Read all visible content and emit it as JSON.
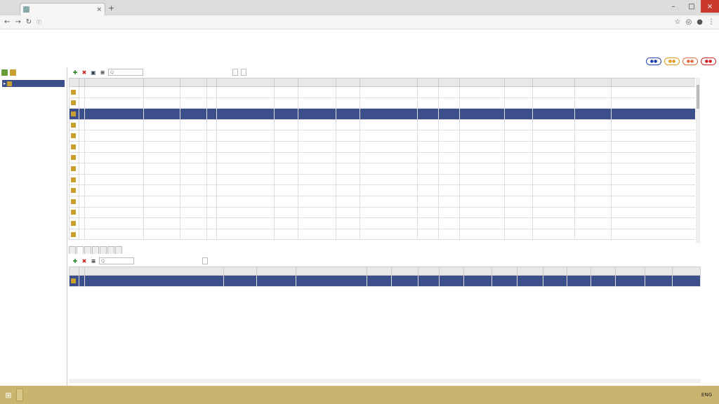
{
  "browser": {
    "tab_title": "",
    "url": "",
    "secure_label": ""
  },
  "menu": {
    "items": [],
    "user": ""
  },
  "breadcrumb": "",
  "tree": {
    "root_label": "",
    "node_label": ""
  },
  "toolbar": {
    "search_placeholder": "Q",
    "go_label": "",
    "page_info": "",
    "actions_label": ""
  },
  "columns": [
    "",
    "",
    "",
    "",
    "",
    "",
    "",
    "",
    "",
    "",
    "",
    "",
    "",
    "",
    "",
    "",
    "",
    ""
  ],
  "rows": [
    [
      "",
      "",
      "",
      "",
      "",
      "",
      "",
      "",
      "",
      "",
      "",
      "",
      "",
      "",
      "",
      "",
      ""
    ],
    [
      "",
      "",
      "",
      "",
      "",
      "",
      "",
      "",
      "",
      "",
      "",
      "",
      "",
      "",
      "",
      "",
      ""
    ],
    [
      "",
      "",
      "",
      "",
      "",
      "",
      "",
      "",
      "",
      "",
      "",
      "",
      "",
      "",
      "",
      "",
      ""
    ],
    [
      "",
      "",
      "",
      "",
      "",
      "",
      "",
      "",
      "",
      "",
      "",
      "",
      "",
      "",
      "",
      "",
      ""
    ],
    [
      "",
      "",
      "",
      "",
      "",
      "",
      "",
      "",
      "",
      "",
      "",
      "",
      "",
      "",
      "",
      "",
      ""
    ],
    [
      "",
      "",
      "",
      "",
      "",
      "",
      "",
      "",
      "",
      "",
      "",
      "",
      "",
      "",
      "",
      "",
      ""
    ],
    [
      "",
      "",
      "",
      "",
      "",
      "",
      "",
      "",
      "",
      "",
      "",
      "",
      "",
      "",
      "",
      "",
      ""
    ],
    [
      "",
      "",
      "",
      "",
      "",
      "",
      "",
      "",
      "",
      "",
      "",
      "",
      "",
      "",
      "",
      "",
      ""
    ],
    [
      "",
      "",
      "",
      "",
      "",
      "",
      "",
      "",
      "",
      "",
      "",
      "",
      "",
      "",
      "",
      "",
      ""
    ],
    [
      "",
      "",
      "",
      "",
      "",
      "",
      "",
      "",
      "",
      "",
      "",
      "",
      "",
      "",
      "",
      "",
      ""
    ],
    [
      "",
      "",
      "",
      "",
      "",
      "",
      "",
      "",
      "",
      "",
      "",
      "",
      "",
      "",
      "",
      "",
      ""
    ],
    [
      "",
      "",
      "",
      "",
      "",
      "",
      "",
      "",
      "",
      "",
      "",
      "",
      "",
      "",
      "",
      "",
      ""
    ],
    [
      "",
      "",
      "",
      "",
      "",
      "",
      "",
      "",
      "",
      "",
      "",
      "",
      "",
      "",
      "",
      "",
      ""
    ],
    [
      "",
      "",
      "",
      "",
      "",
      "",
      "",
      "",
      "",
      "",
      "",
      "",
      "",
      "",
      "",
      "",
      ""
    ]
  ],
  "selected_row": 2,
  "lower_tabs": [],
  "lower_toolbar": {
    "go_label": "",
    "actions_label": "",
    "page_info": ""
  },
  "lower_columns": [
    "",
    "",
    "",
    "",
    "",
    "",
    "",
    "",
    "",
    "",
    "",
    "",
    "",
    "",
    "",
    "",
    "",
    "",
    ""
  ],
  "lower_rows": [
    [
      "",
      "",
      "",
      "",
      "",
      "",
      "",
      "",
      "",
      "",
      "",
      "",
      "",
      "",
      "",
      "",
      "",
      ""
    ]
  ],
  "taskbar": {
    "start_label": "",
    "items": [],
    "lang": "ENG",
    "time": ""
  },
  "colors": {
    "selection": "#3c4f8a",
    "taskbar": "#c9b56f"
  }
}
